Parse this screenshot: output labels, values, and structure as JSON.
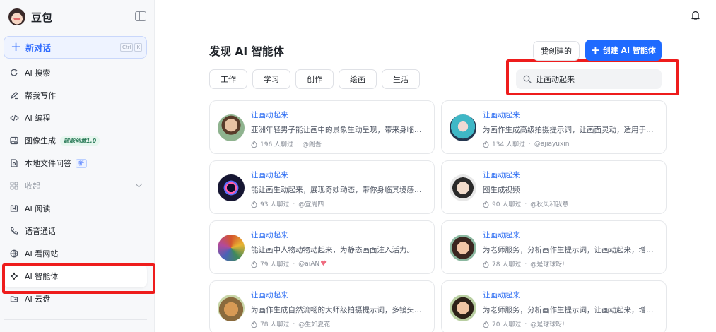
{
  "brand": {
    "name": "豆包"
  },
  "new_chat": {
    "label": "新对话",
    "shortcut": [
      "Ctrl",
      "K"
    ]
  },
  "nav": [
    {
      "icon": "search-refresh-icon",
      "label": "AI 搜索"
    },
    {
      "icon": "pen-icon",
      "label": "帮我写作"
    },
    {
      "icon": "code-icon",
      "label": "AI 编程"
    },
    {
      "icon": "image-icon",
      "label": "图像生成",
      "tag": "超能创意1.0"
    },
    {
      "icon": "file-qa-icon",
      "label": "本地文件问答",
      "tag": "新"
    },
    {
      "icon": "grid-icon",
      "label": "收起"
    },
    {
      "icon": "book-icon",
      "label": "AI 阅读"
    },
    {
      "icon": "phone-icon",
      "label": "语音通话"
    },
    {
      "icon": "globe-icon",
      "label": "AI 看网站"
    },
    {
      "icon": "sparkle-icon",
      "label": "AI 智能体"
    },
    {
      "icon": "cloud-drive-icon",
      "label": "AI 云盘"
    }
  ],
  "main": {
    "title": "发现 AI 智能体",
    "mine_label": "我创建的",
    "create_label": "创建 AI 智能体",
    "categories": [
      "工作",
      "学习",
      "创作",
      "绘画",
      "生活"
    ],
    "search": {
      "value": "让画动起来",
      "placeholder": ""
    }
  },
  "agents": [
    {
      "title": "让画动起来",
      "desc": "亚洲年轻男子能让画中的景象生动呈现，带来身临其境的体验",
      "count": "196 人聊过",
      "author": "@阁吾"
    },
    {
      "title": "让画动起来",
      "desc": "为画作生成高级拍摄提示词，让画面灵动，适用于多种场景",
      "count": "134 人聊过",
      "author": "@ajiayuxin"
    },
    {
      "title": "让画动起来",
      "desc": "能让画生动起来，展现奇妙动态，带你身临其境感受画中世界",
      "count": "93 人聊过",
      "author": "@宜周四"
    },
    {
      "title": "让画动起来",
      "desc": "图生成视频",
      "count": "90 人聊过",
      "author": "@秋风和我意"
    },
    {
      "title": "让画动起来",
      "desc": "能让画中人物动物动起来，为静态画面注入活力。",
      "count": "79 人聊过",
      "author": "@aiAN"
    },
    {
      "title": "让画动起来",
      "desc": "为老师服务，分析画作生提示词，让画动起来，增加课堂趣味",
      "count": "78 人聊过",
      "author": "@是球球呀!"
    },
    {
      "title": "让画动起来",
      "desc": "为画作生成自然流畅的大师级拍摄提示词，多镜头运镜切换",
      "count": "78 人聊过",
      "author": "@生如夏花"
    },
    {
      "title": "让画动起来",
      "desc": "为老师服务，分析画作生提示词，让画动起来，增加课堂趣味",
      "count": "70 人聊过",
      "author": "@是球球呀!"
    }
  ],
  "meta_separator": "·",
  "highlight_color": "#ee1c1c",
  "accent_color": "#1f6bff"
}
